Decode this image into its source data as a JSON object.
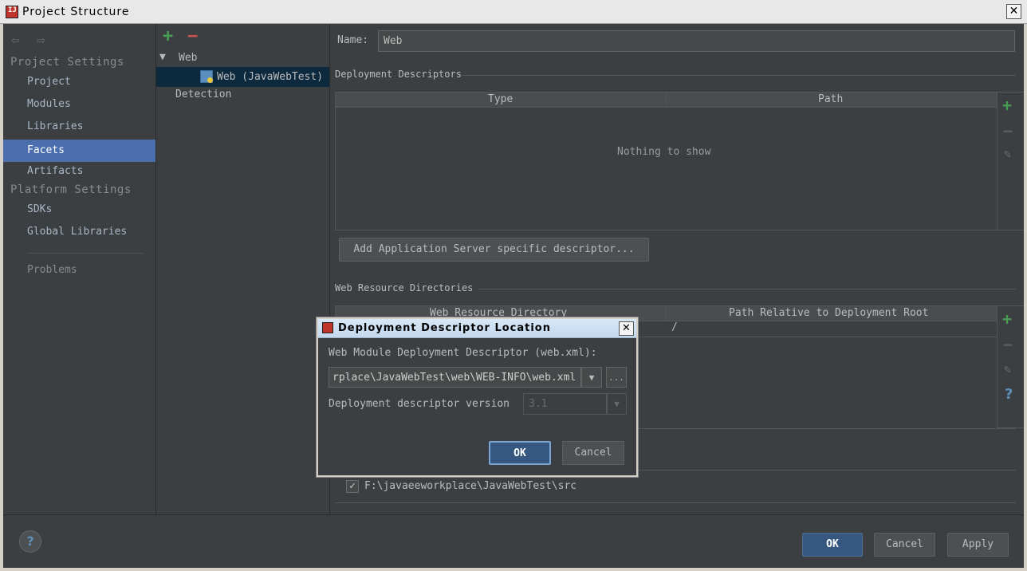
{
  "window": {
    "title": "Project Structure",
    "close_icon": "close-icon"
  },
  "left_nav": {
    "back_icon": "back-arrow-icon",
    "forward_icon": "forward-arrow-icon",
    "project_settings_header": "Project Settings",
    "project_items": [
      "Project",
      "Modules",
      "Libraries",
      "Facets",
      "Artifacts"
    ],
    "platform_settings_header": "Platform Settings",
    "platform_items": [
      "SDKs",
      "Global Libraries"
    ],
    "problems": "Problems",
    "selected": "Facets"
  },
  "facet_tree": {
    "add_icon": "plus-icon",
    "remove_icon": "minus-icon",
    "root": "Web",
    "child": "Web (JavaWebTest)",
    "detection": "Detection"
  },
  "detail": {
    "name_label": "Name:",
    "name_value": "Web",
    "deployment_descriptors_title": "Deployment Descriptors",
    "dd_columns": [
      "Type",
      "Path"
    ],
    "dd_empty": "Nothing to show",
    "add_server_descriptor_button": "Add Application Server specific descriptor...",
    "web_resource_title": "Web Resource Directories",
    "wr_columns": [
      "Web Resource Directory",
      "Path Relative to Deployment Root"
    ],
    "wr_row_path": "/",
    "source_root": "F:\\javaeeworkplace\\JavaWebTest\\src"
  },
  "dialog": {
    "title": "Deployment Descriptor Location",
    "module_label": "Web Module Deployment Descriptor (web.xml):",
    "path_value": "rplace\\JavaWebTest\\web\\WEB-INFO\\web.xml",
    "browse_label": "...",
    "version_label": "Deployment descriptor version",
    "version_value": "3.1",
    "ok": "OK",
    "cancel": "Cancel"
  },
  "footer": {
    "ok": "OK",
    "cancel": "Cancel",
    "apply": "Apply",
    "help": "?"
  },
  "colors": {
    "selection": "#4b6eaf",
    "background": "#3c3f41",
    "add": "#499c54",
    "remove": "#c75450"
  }
}
